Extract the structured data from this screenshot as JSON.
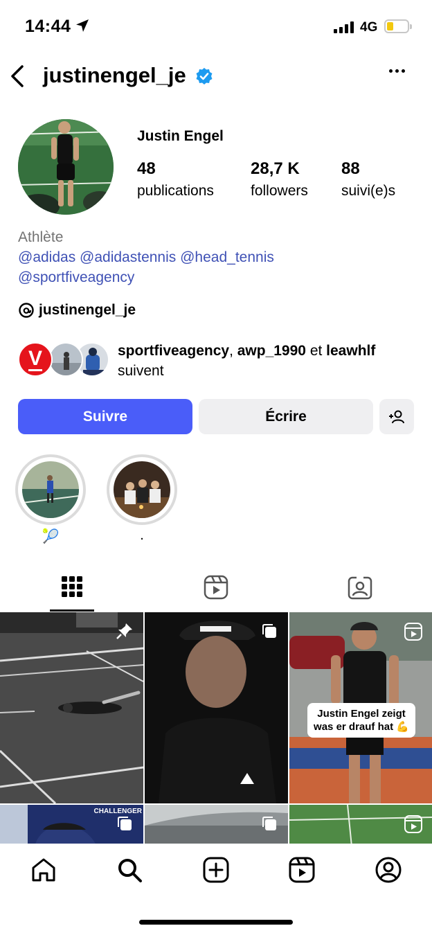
{
  "status_bar": {
    "time": "14:44",
    "network": "4G",
    "battery_level": 0.25,
    "battery_color": "#f2c80f"
  },
  "header": {
    "username": "justinengel_je",
    "verified": true,
    "verified_color": "#1d9bf0",
    "back_icon": "chevron-left-icon",
    "more_icon": "more-horizontal-icon"
  },
  "profile": {
    "display_name": "Justin Engel",
    "stats": [
      {
        "value": "48",
        "label": "publications"
      },
      {
        "value": "28,7 K",
        "label": "followers"
      },
      {
        "value": "88",
        "label": "suivi(e)s"
      }
    ],
    "category": "Athlète",
    "bio_line_1": "@adidas @adidastennis @head_tennis",
    "bio_line_2": "@sportfiveagency",
    "link_color": "#3f51b5",
    "threads_handle": "justinengel_je"
  },
  "followed_by": {
    "user_1": "sportfiveagency",
    "separator_1": ", ",
    "user_2": "awp_1990",
    "separator_2": " et ",
    "user_3": "leawhlf",
    "suffix": "suivent",
    "badge_letter": "V"
  },
  "actions": {
    "follow_label": "Suivre",
    "message_label": "Écrire",
    "follow_color": "#4a5df9"
  },
  "highlights": [
    {
      "label": "🎾"
    },
    {
      "label": "."
    }
  ],
  "tabs": [
    {
      "icon": "grid-icon",
      "active": true
    },
    {
      "icon": "reels-icon",
      "active": false
    },
    {
      "icon": "tagged-icon",
      "active": false
    }
  ],
  "grid": {
    "reel_caption_line_1": "Justin Engel zeigt",
    "reel_caption_line_2": "was er drauf hat 💪",
    "post_4_overlay": "CHALLENGER"
  },
  "bottom_nav": [
    {
      "icon": "home-icon"
    },
    {
      "icon": "search-icon"
    },
    {
      "icon": "create-icon"
    },
    {
      "icon": "reels-icon"
    },
    {
      "icon": "profile-icon"
    }
  ]
}
